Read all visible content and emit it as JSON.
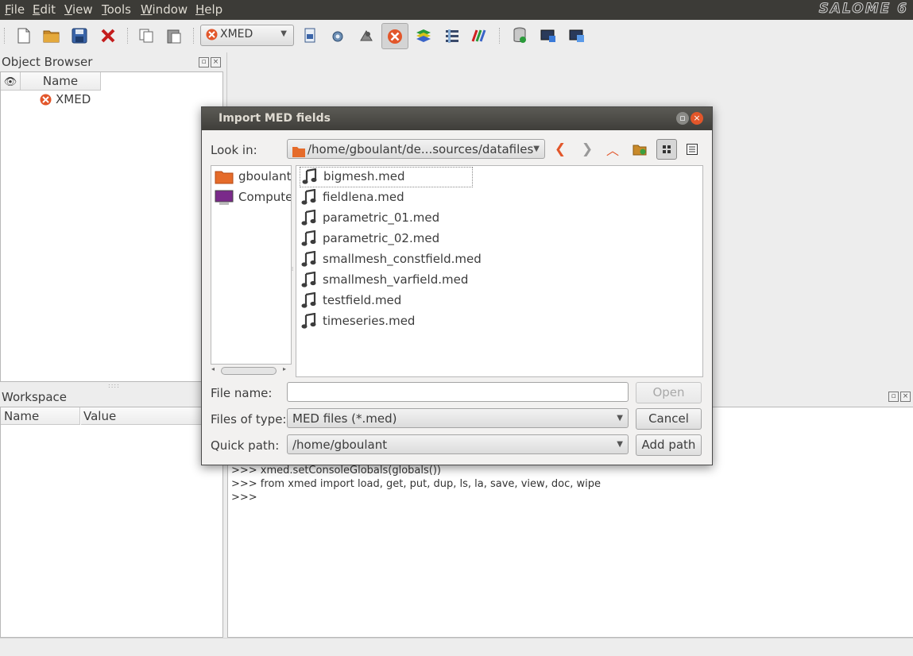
{
  "menubar": {
    "items": [
      {
        "label": "File",
        "underline": "F",
        "rest": "ile"
      },
      {
        "label": "Edit",
        "underline": "E",
        "rest": "dit"
      },
      {
        "label": "View",
        "underline": "V",
        "rest": "iew"
      },
      {
        "label": "Tools",
        "underline": "T",
        "rest": "ools"
      },
      {
        "label": "Window",
        "underline": "W",
        "rest": "indow"
      },
      {
        "label": "Help",
        "underline": "H",
        "rest": "elp"
      }
    ],
    "brand": "SALOME 6"
  },
  "toolbar": {
    "module_selected": "XMED",
    "icons": [
      "new-document-icon",
      "open-folder-icon",
      "save-icon",
      "close-document-icon",
      "copy-icon",
      "paste-icon",
      "module-icon-1",
      "module-icon-2",
      "module-icon-3",
      "xmed-module-icon",
      "module-icon-4",
      "module-icon-5",
      "module-icon-6",
      "database-icon",
      "dump-icon",
      "load-script-icon"
    ]
  },
  "object_browser": {
    "title": "Object Browser",
    "column_name": "Name",
    "items": [
      "XMED"
    ]
  },
  "workspace": {
    "title": "Workspace",
    "columns": [
      "Name",
      "Value"
    ]
  },
  "console": {
    "lines": [
      ">>> xmed.setConsoleGlobals(globals())",
      ">>> from xmed import load, get, put, dup, ls, la, save, view, doc, wipe",
      ">>>"
    ]
  },
  "dialog": {
    "title": "Import MED fields",
    "look_in_label": "Look in:",
    "look_in_path": "/home/gboulant/de...sources/datafiles",
    "places": [
      "gboulant",
      "Computer"
    ],
    "files": [
      "bigmesh.med",
      "fieldlena.med",
      "parametric_01.med",
      "parametric_02.med",
      "smallmesh_constfield.med",
      "smallmesh_varfield.med",
      "testfield.med",
      "timeseries.med"
    ],
    "file_name_label": "File name:",
    "file_name_value": "",
    "files_of_type_label": "Files of type:",
    "files_of_type_value": "MED files (*.med)",
    "quick_path_label": "Quick path:",
    "quick_path_value": "/home/gboulant",
    "open_button": "Open",
    "cancel_button": "Cancel",
    "add_path_button": "Add path"
  },
  "colors": {
    "menubar_bg": "#3c3b37",
    "accent_orange": "#e2562a",
    "selection_border": "#9a9a9a"
  }
}
